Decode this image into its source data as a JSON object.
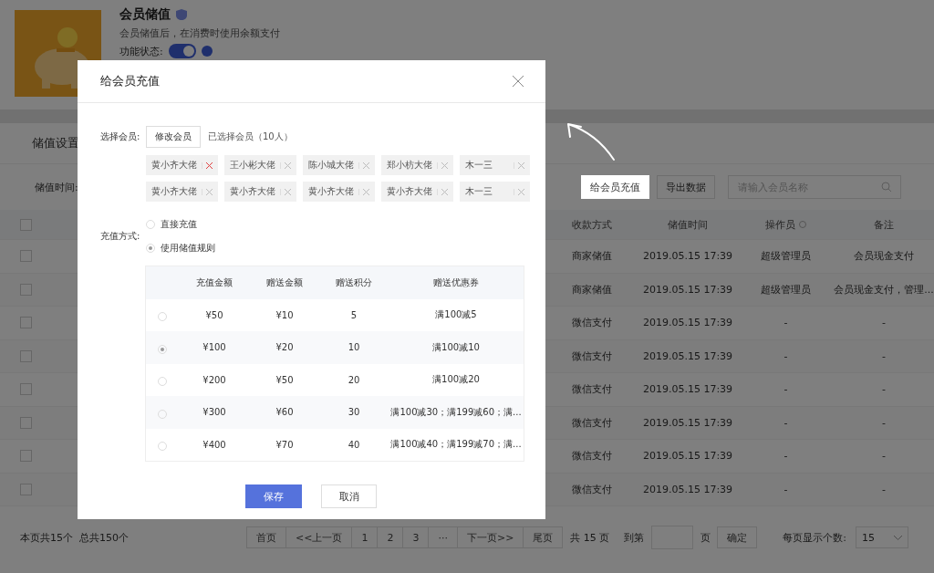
{
  "feature": {
    "title": "会员储值",
    "description": "会员储值后，在消费时使用余额支付",
    "status_label": "功能状态:",
    "enabled": true
  },
  "section_title": "储值设置",
  "filter": {
    "label": "储值时间:"
  },
  "toolbar": {
    "buttons": [
      {
        "label": "给会员充值",
        "highlighted": true
      },
      {
        "label": "导出数据",
        "highlighted": false
      }
    ],
    "search_placeholder": "请输入会员名称"
  },
  "table": {
    "select_all_checked": false,
    "columns": [
      {
        "label": "收款方式",
        "info": false
      },
      {
        "label": "储值时间",
        "info": false
      },
      {
        "label": "操作员",
        "info": true
      },
      {
        "label": "备注",
        "info": false
      }
    ],
    "rows": [
      {
        "checked": false,
        "cells": [
          "商家储值",
          "2019.05.15  17:39",
          "超级管理员",
          "会员现金支付"
        ]
      },
      {
        "checked": false,
        "cells": [
          "商家储值",
          "2019.05.15  17:39",
          "超级管理员",
          "会员现金支付，管理..."
        ]
      },
      {
        "checked": false,
        "cells": [
          "微信支付",
          "2019.05.15  17:39",
          "-",
          "-"
        ]
      },
      {
        "checked": false,
        "cells": [
          "微信支付",
          "2019.05.15  17:39",
          "-",
          "-"
        ]
      },
      {
        "checked": false,
        "cells": [
          "微信支付",
          "2019.05.15  17:39",
          "-",
          "-"
        ]
      },
      {
        "checked": false,
        "cells": [
          "微信支付",
          "2019.05.15  17:39",
          "-",
          "-"
        ]
      },
      {
        "checked": false,
        "cells": [
          "微信支付",
          "2019.05.15  17:39",
          "-",
          "-"
        ]
      },
      {
        "checked": false,
        "cells": [
          "微信支付",
          "2019.05.15  17:39",
          "-",
          "-"
        ]
      }
    ]
  },
  "footer": {
    "summary": "本页共15个  总共150个",
    "pages": [
      {
        "label": "首页",
        "selected": false
      },
      {
        "label": "<<上一页",
        "selected": false
      },
      {
        "label": "1",
        "selected": false
      },
      {
        "label": "2",
        "selected": false
      },
      {
        "label": "3",
        "selected": false
      },
      {
        "label": "···",
        "selected": false
      },
      {
        "label": "下一页>>",
        "selected": false
      },
      {
        "label": "尾页",
        "selected": false
      }
    ],
    "total": "共 15 页",
    "goto_label": "到第",
    "goto_unit": "页",
    "confirm": "确定",
    "page_size_label": "每页显示个数:",
    "page_size": "15"
  },
  "dialog": {
    "title": "给会员充值",
    "member_label": "选择会员:",
    "edit_button": "修改会员",
    "selected_count": "已选择会员（10人）",
    "members": [
      {
        "name": "黄小齐大佬",
        "active": true
      },
      {
        "name": "王小彬大佬",
        "active": false
      },
      {
        "name": "陈小城大佬",
        "active": false
      },
      {
        "name": "郑小枋大佬",
        "active": false
      },
      {
        "name": "木一三",
        "active": false
      },
      {
        "name": "黄小齐大佬",
        "active": false
      },
      {
        "name": "黄小齐大佬",
        "active": false
      },
      {
        "name": "黄小齐大佬",
        "active": false
      },
      {
        "name": "黄小齐大佬",
        "active": false
      },
      {
        "name": "木一三",
        "active": false
      }
    ],
    "method_label": "充值方式:",
    "methods": [
      {
        "label": "直接充值",
        "selected": false
      },
      {
        "label": "使用储值规则",
        "selected": true
      }
    ],
    "rules": {
      "columns": [
        "充值金额",
        "赠送金额",
        "赠送积分",
        "赠送优惠券"
      ],
      "rows": [
        {
          "selected": false,
          "cells": [
            "¥50",
            "¥10",
            "5",
            "满100减5"
          ]
        },
        {
          "selected": true,
          "cells": [
            "¥100",
            "¥20",
            "10",
            "满100减10"
          ]
        },
        {
          "selected": false,
          "cells": [
            "¥200",
            "¥50",
            "20",
            "满100减20"
          ]
        },
        {
          "selected": false,
          "cells": [
            "¥300",
            "¥60",
            "30",
            "满100减30；满199减60；满..."
          ]
        },
        {
          "selected": false,
          "cells": [
            "¥400",
            "¥70",
            "40",
            "满100减40；满199减70；满..."
          ]
        }
      ]
    },
    "save": "保存",
    "cancel": "取消"
  }
}
